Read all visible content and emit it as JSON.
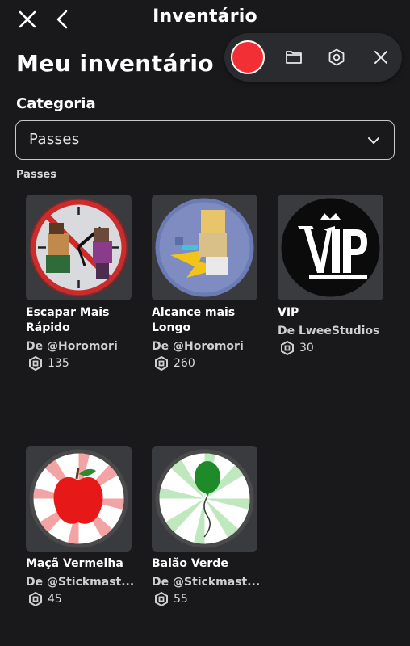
{
  "header": {
    "title": "Inventário",
    "close_icon": "close-icon",
    "back_icon": "chevron-left-icon"
  },
  "recorder": {
    "record_icon": "record-button",
    "folder_icon": "folder-icon",
    "settings_icon": "settings-hex-icon",
    "close_icon": "close-icon",
    "record_color": "#f12f35"
  },
  "page_title": "Meu inventário",
  "category": {
    "label": "Categoria",
    "selected": "Passes",
    "chevron_icon": "chevron-down-icon"
  },
  "section": {
    "label": "Passes"
  },
  "items": [
    {
      "name": "Escapar Mais Rápido",
      "creator": "De @Horomori",
      "price": "135",
      "icon": "clock-runners-image"
    },
    {
      "name": "Alcance mais Longo",
      "creator": "De @Horomori",
      "price": "260",
      "icon": "long-reach-image"
    },
    {
      "name": "VIP",
      "creator": "De LweeStudios",
      "price": "30",
      "icon": "vip-crown-image"
    },
    {
      "name": "Maçã Vermelha",
      "creator": "De @Stickmast...",
      "price": "45",
      "icon": "red-apple-image"
    },
    {
      "name": "Balão Verde",
      "creator": "De @Stickmast...",
      "price": "55",
      "icon": "green-balloon-image"
    }
  ],
  "colors": {
    "background": "#19191b",
    "card": "#393b3f",
    "recorder_bg": "#2a2b2e",
    "text": "#ffffff"
  }
}
